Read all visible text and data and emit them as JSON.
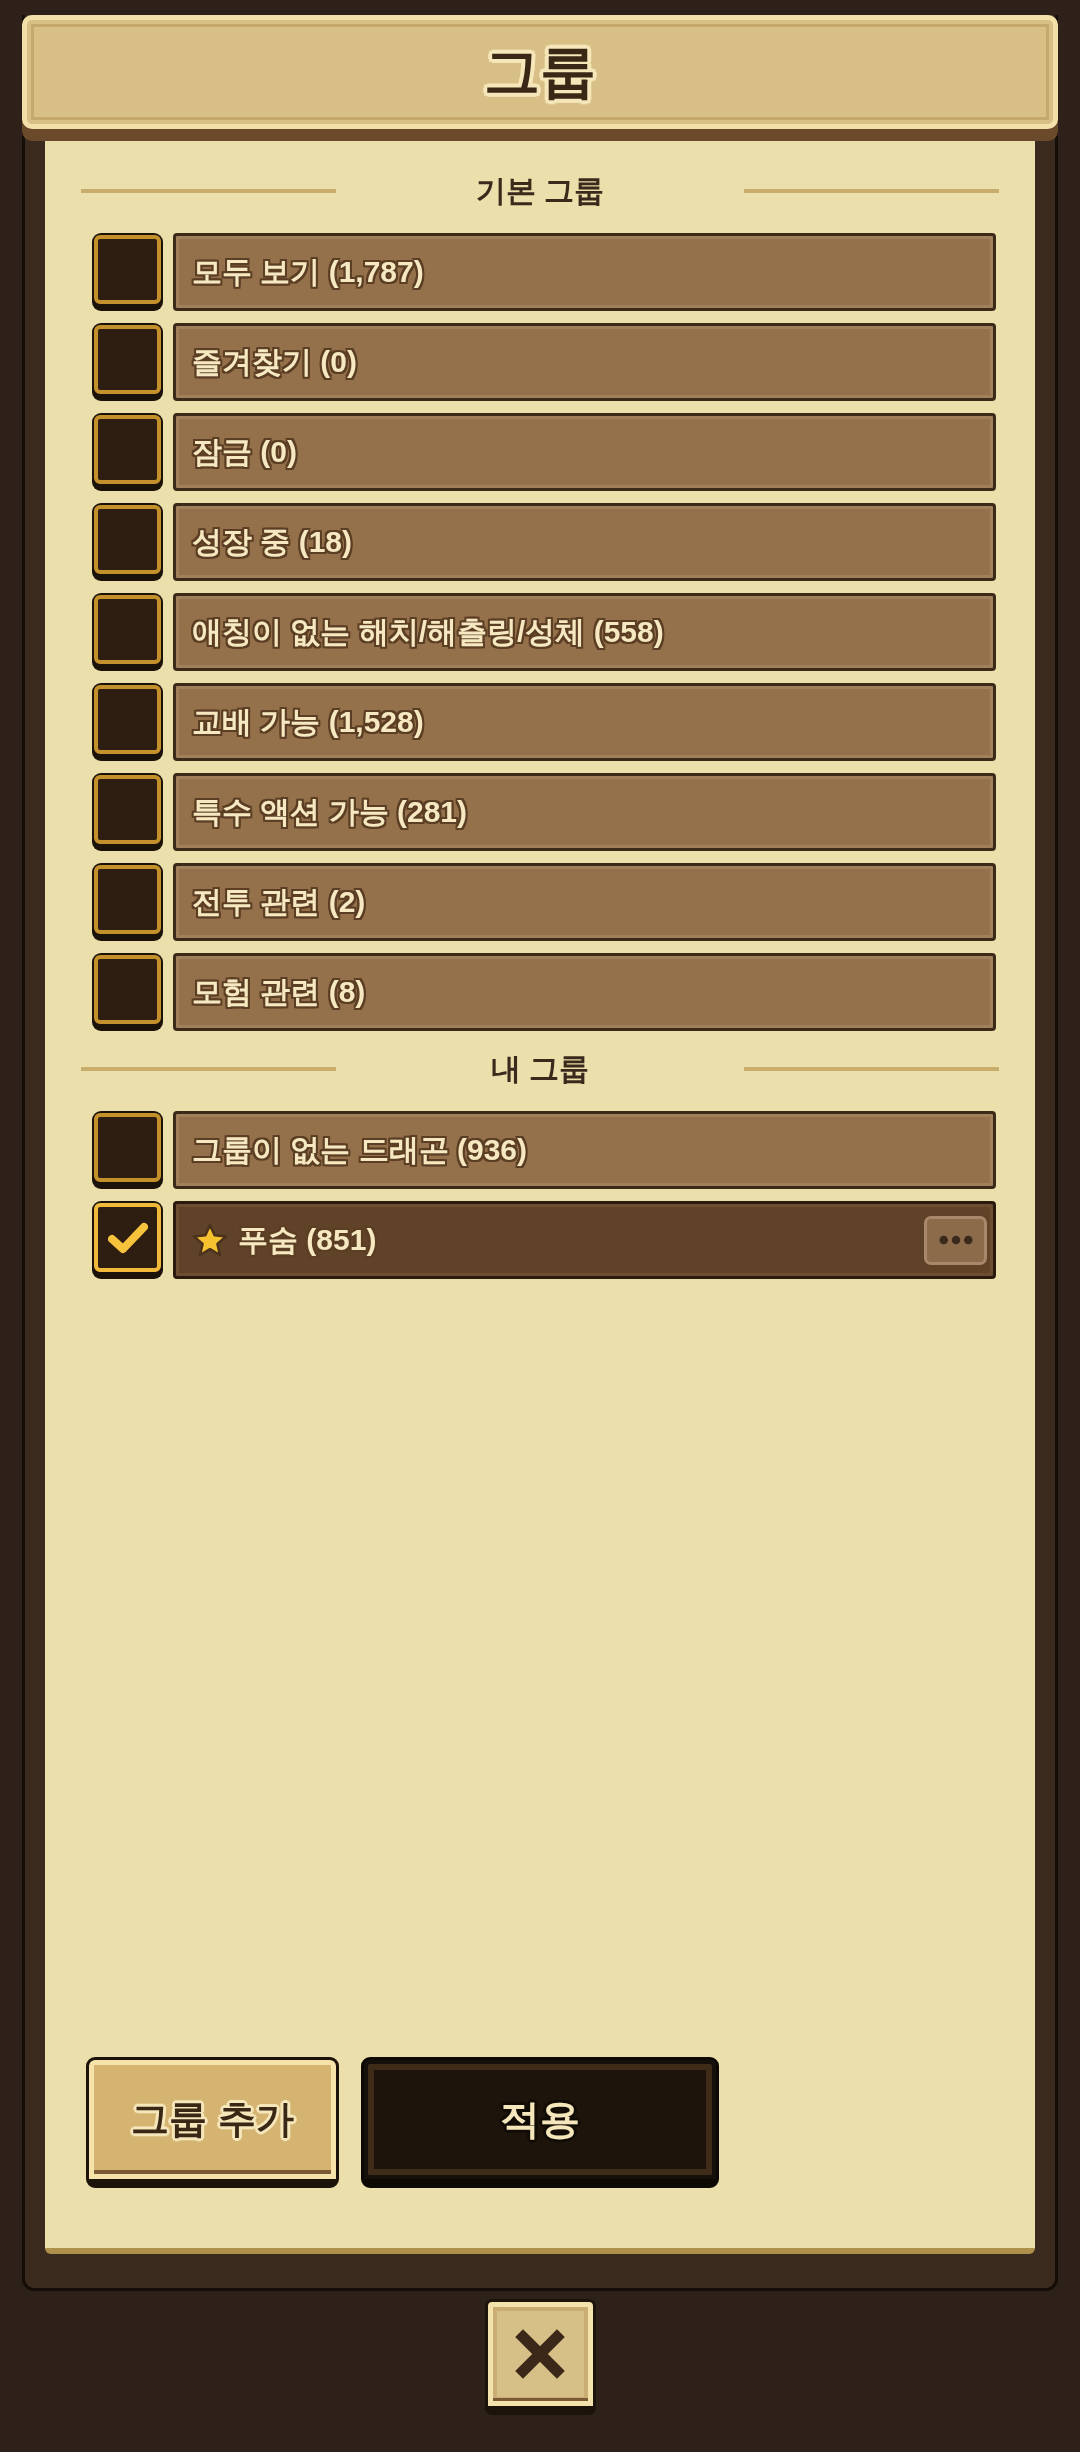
{
  "dialog": {
    "title": "그룹"
  },
  "sections": [
    {
      "heading": "기본 그룹",
      "groups": [
        {
          "label": "모두 보기 (1,787)",
          "checked": false,
          "starred": false,
          "has_menu": false
        },
        {
          "label": "즐겨찾기 (0)",
          "checked": false,
          "starred": false,
          "has_menu": false
        },
        {
          "label": "잠금 (0)",
          "checked": false,
          "starred": false,
          "has_menu": false
        },
        {
          "label": "성장 중 (18)",
          "checked": false,
          "starred": false,
          "has_menu": false
        },
        {
          "label": "애칭이 없는 해치/해츨링/성체 (558)",
          "checked": false,
          "starred": false,
          "has_menu": false
        },
        {
          "label": "교배 가능 (1,528)",
          "checked": false,
          "starred": false,
          "has_menu": false
        },
        {
          "label": "특수 액션 가능 (281)",
          "checked": false,
          "starred": false,
          "has_menu": false
        },
        {
          "label": "전투 관련 (2)",
          "checked": false,
          "starred": false,
          "has_menu": false
        },
        {
          "label": "모험 관련 (8)",
          "checked": false,
          "starred": false,
          "has_menu": false
        }
      ]
    },
    {
      "heading": "내 그룹",
      "groups": [
        {
          "label": "그룹이 없는 드래곤 (936)",
          "checked": false,
          "starred": false,
          "has_menu": false
        },
        {
          "label": "푸숨 (851)",
          "checked": true,
          "starred": true,
          "has_menu": true
        }
      ]
    }
  ],
  "buttons": [
    {
      "label": "그룹 추가",
      "kind": "light"
    },
    {
      "label": "적용",
      "kind": "dark"
    }
  ]
}
